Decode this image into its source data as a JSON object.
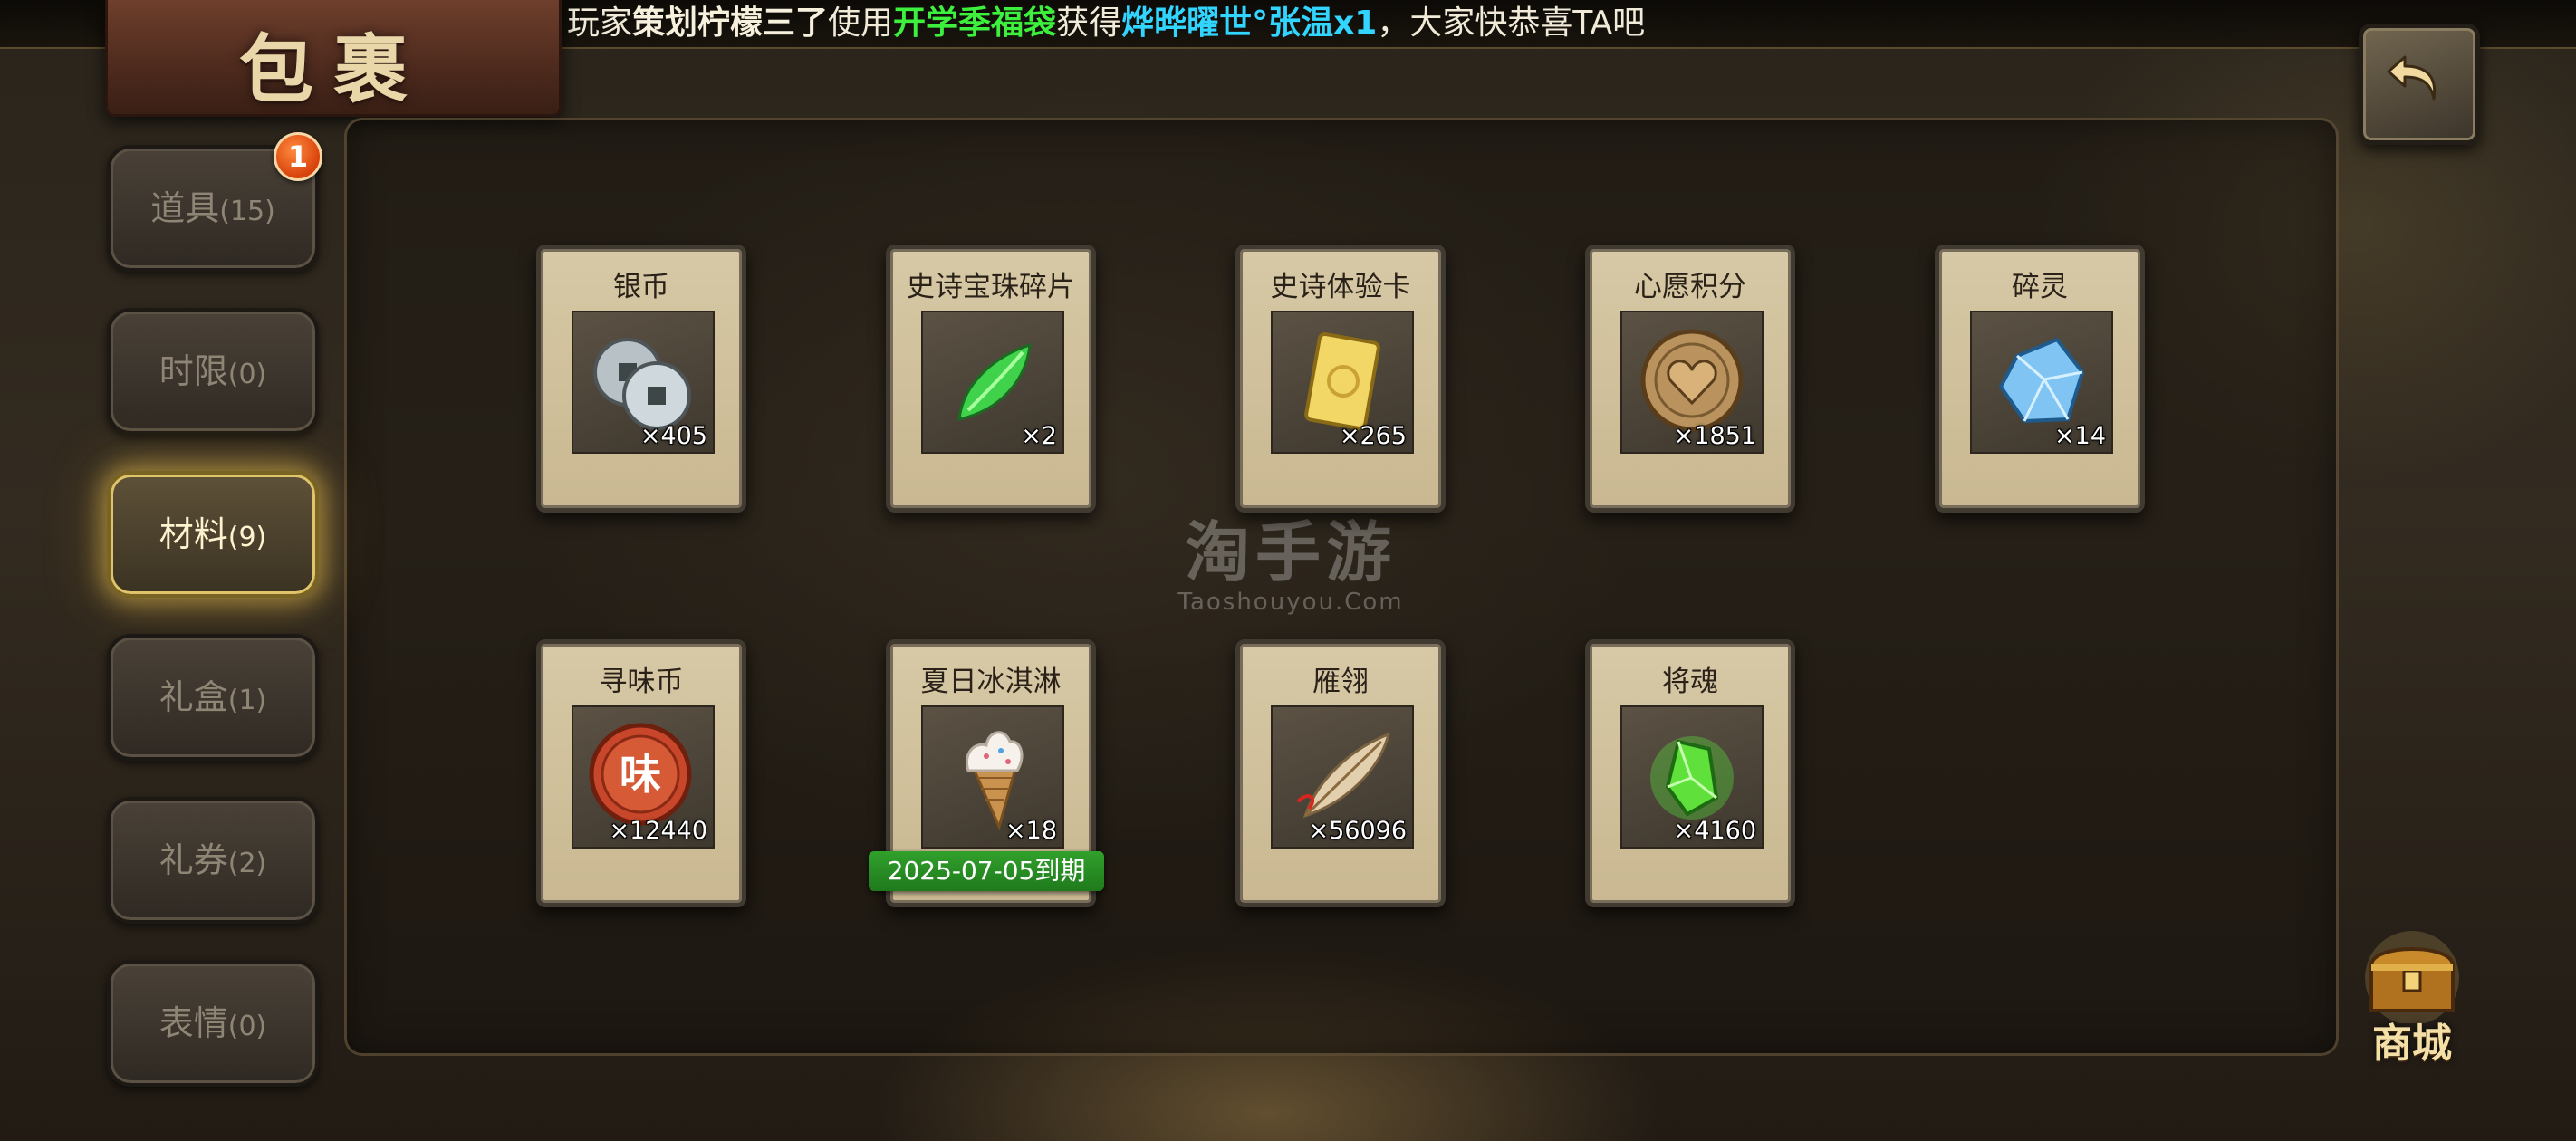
{
  "ticker": {
    "prefix": "玩家",
    "player": "策划柠檬三了",
    "used": "使用",
    "event": "开学季福袋",
    "obtained": "获得",
    "reward": "烨晔曜世°张温x1",
    "suffix": "，大家快恭喜TA吧"
  },
  "header": {
    "title": "包裹"
  },
  "tabs": [
    {
      "label": "道具",
      "count": "(15)",
      "badge": "1"
    },
    {
      "label": "时限",
      "count": "(0)"
    },
    {
      "label": "材料",
      "count": "(9)",
      "active": true
    },
    {
      "label": "礼盒",
      "count": "(1)"
    },
    {
      "label": "礼券",
      "count": "(2)"
    },
    {
      "label": "表情",
      "count": "(0)"
    }
  ],
  "items": [
    {
      "name": "银币",
      "qty": "×405",
      "icon": "silver-coin-icon"
    },
    {
      "name": "史诗宝珠碎片",
      "qty": "×2",
      "icon": "green-shard-icon"
    },
    {
      "name": "史诗体验卡",
      "qty": "×265",
      "icon": "gold-card-icon"
    },
    {
      "name": "心愿积分",
      "qty": "×1851",
      "icon": "heart-coin-icon"
    },
    {
      "name": "碎灵",
      "qty": "×14",
      "icon": "blue-crystal-icon"
    },
    {
      "name": "寻味币",
      "qty": "×12440",
      "icon": "flavor-coin-icon",
      "coin_glyph": "味"
    },
    {
      "name": "夏日冰淇淋",
      "qty": "×18",
      "icon": "ice-cream-icon",
      "expiry": "2025-07-05到期"
    },
    {
      "name": "雁翎",
      "qty": "×56096",
      "icon": "feather-icon"
    },
    {
      "name": "将魂",
      "qty": "×4160",
      "icon": "green-spirit-crystal-icon"
    }
  ],
  "watermark": {
    "main": "淘手游",
    "sub": "Taoshouyou.Com"
  },
  "shop": {
    "label": "商城",
    "icon": "treasure-chest-icon"
  },
  "back": {
    "icon": "back-arrow-icon"
  },
  "colors": {
    "ticker_event": "#3df03d",
    "ticker_reward": "#31d5ff",
    "expiry_tag": "#2a8f25",
    "badge": "#e2531a",
    "active_tab_glow": "#e0c46a"
  }
}
